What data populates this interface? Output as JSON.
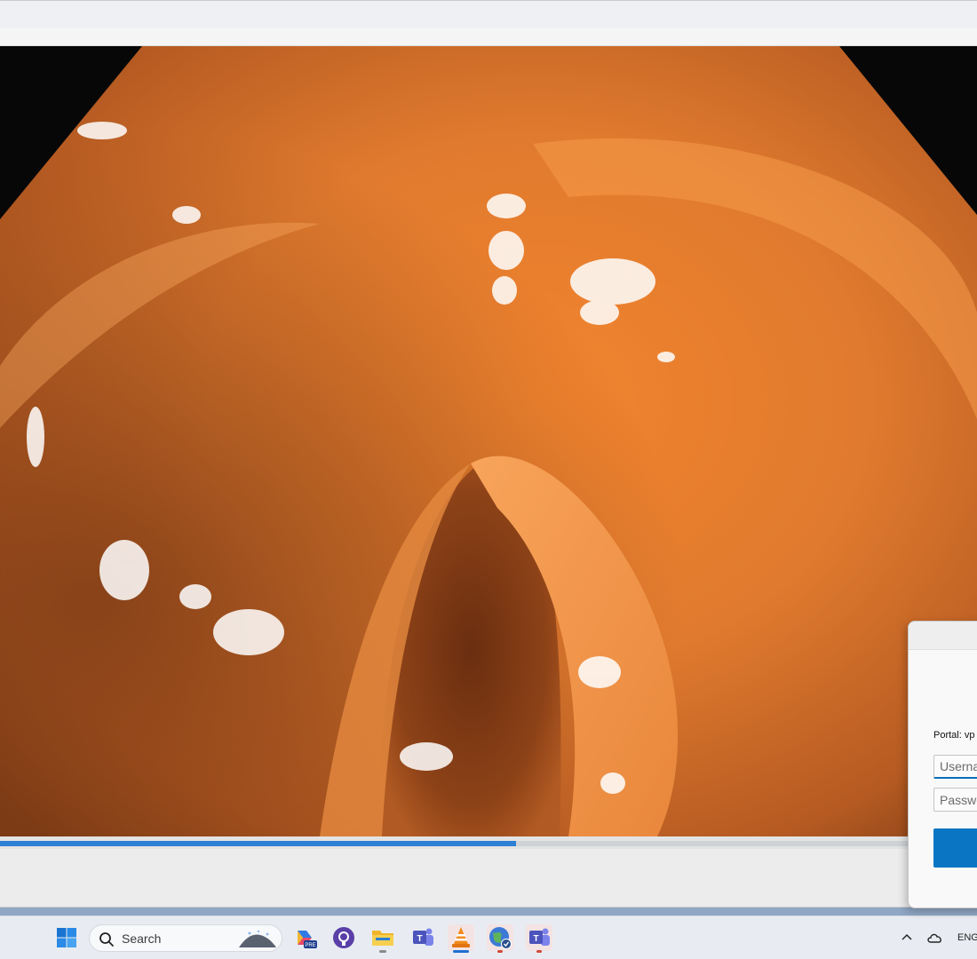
{
  "video": {
    "playback_progress_percent": 52.8
  },
  "taskbar": {
    "search_placeholder": "Search",
    "apps": [
      {
        "name": "windows-start-icon"
      },
      {
        "name": "search-icon"
      },
      {
        "name": "copilot-pre-icon",
        "badge": "PRE"
      },
      {
        "name": "github-icon"
      },
      {
        "name": "file-explorer-icon"
      },
      {
        "name": "teams-icon"
      },
      {
        "name": "vlc-icon"
      },
      {
        "name": "globe-vpn-icon"
      },
      {
        "name": "teams-alt-icon"
      }
    ],
    "tray": {
      "language": "ENG"
    }
  },
  "vpn_dialog": {
    "portal_label": "Portal: vp",
    "username_placeholder": "Userna",
    "password_placeholder": "Passwo"
  },
  "colors": {
    "accent": "#0a76c3",
    "seek_fill": "#2d7fd3"
  }
}
